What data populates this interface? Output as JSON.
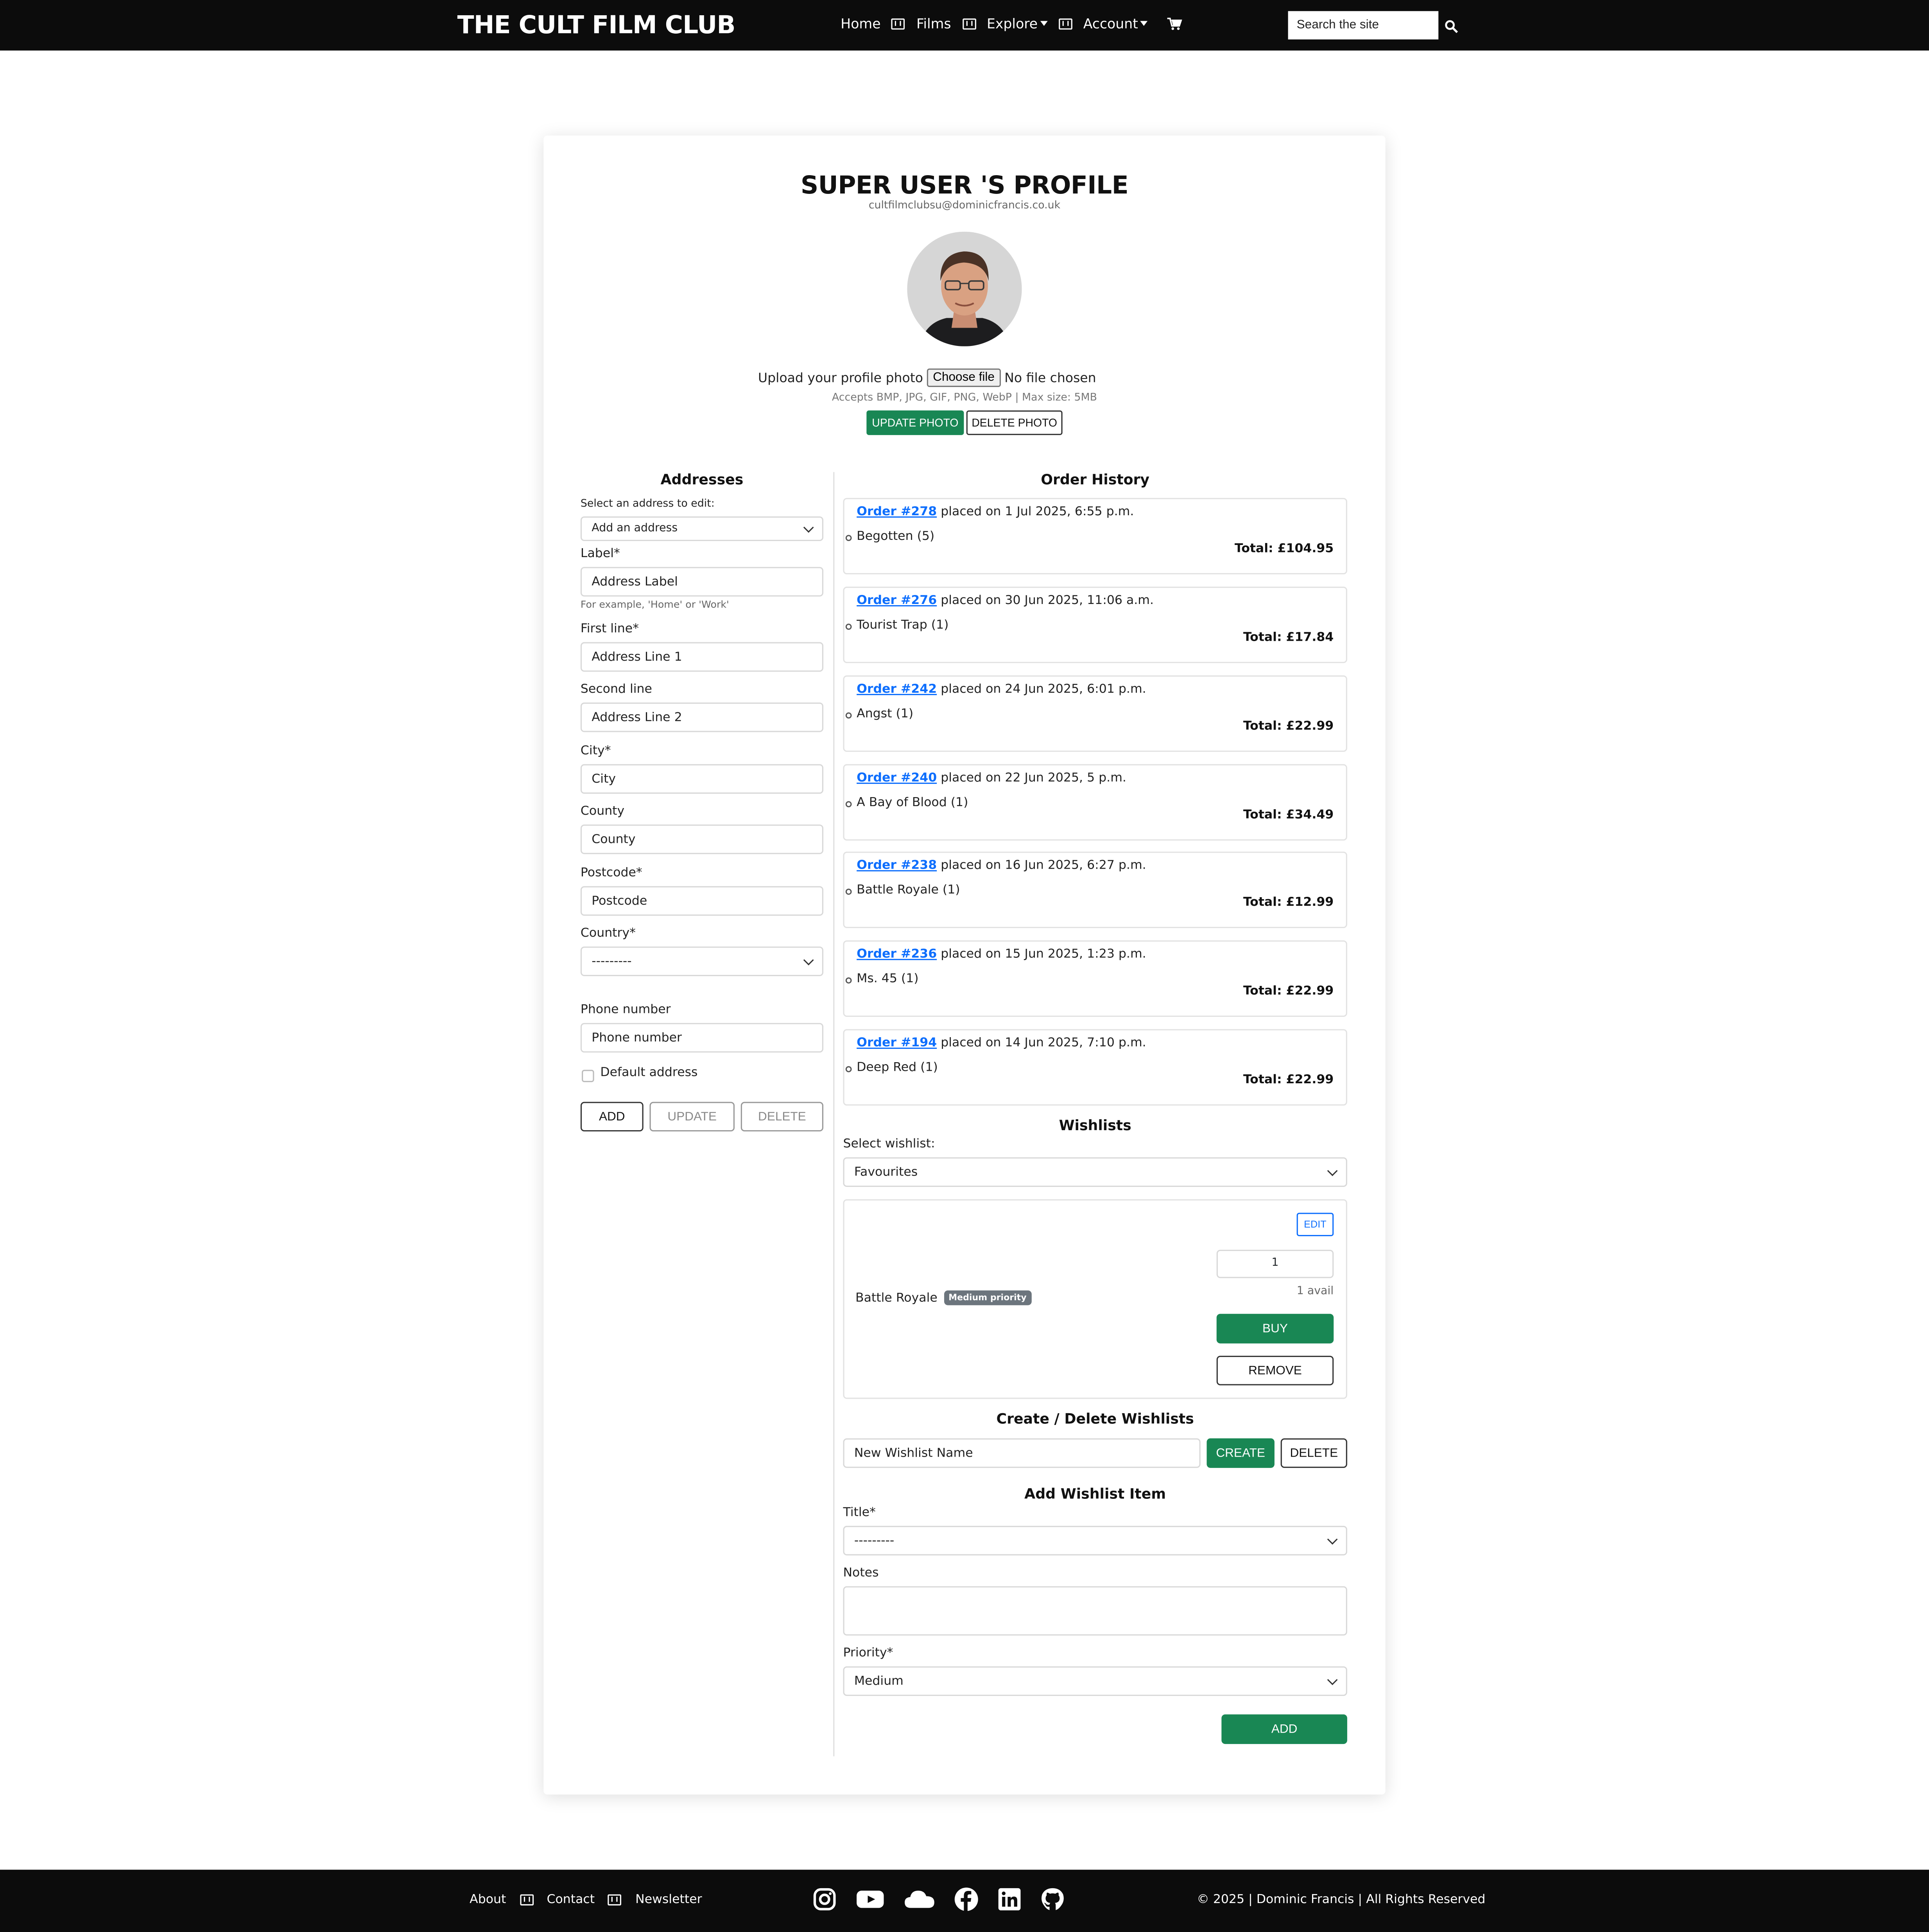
{
  "header": {
    "brand": "THE CULT FILM CLUB",
    "nav": {
      "home": "Home",
      "films": "Films",
      "explore": "Explore",
      "account": "Account"
    },
    "search_placeholder": "Search the site"
  },
  "profile": {
    "title": "SUPER USER 'S PROFILE",
    "email": "cultfilmclubsu@dominicfrancis.co.uk",
    "upload_label": "Upload your profile photo",
    "choose_file": "Choose file",
    "no_file": "No file chosen",
    "accepts": "Accepts BMP, JPG, GIF, PNG, WebP | Max size: 5MB",
    "update_photo": "UPDATE PHOTO",
    "delete_photo": "DELETE PHOTO"
  },
  "addresses": {
    "heading": "Addresses",
    "select_label": "Select an address to edit:",
    "select_value": "Add an address",
    "label_label": "Label*",
    "label_placeholder": "Address Label",
    "label_help": "For example, 'Home' or 'Work'",
    "first_line_label": "First line*",
    "first_line_placeholder": "Address Line 1",
    "second_line_label": "Second line",
    "second_line_placeholder": "Address Line 2",
    "city_label": "City*",
    "city_placeholder": "City",
    "county_label": "County",
    "county_placeholder": "County",
    "postcode_label": "Postcode*",
    "postcode_placeholder": "Postcode",
    "country_label": "Country*",
    "country_value": "---------",
    "phone_label": "Phone number",
    "phone_placeholder": "Phone number",
    "default_label": "Default address",
    "add": "ADD",
    "update": "UPDATE",
    "delete": "DELETE"
  },
  "orders": {
    "heading": "Order History",
    "items": [
      {
        "number": "Order #278",
        "placed": "placed on 1 Jul 2025, 6:55 p.m.",
        "item": "Begotten (5)",
        "total": "Total: £104.95"
      },
      {
        "number": "Order #276",
        "placed": "placed on 30 Jun 2025, 11:06 a.m.",
        "item": "Tourist Trap (1)",
        "total": "Total: £17.84"
      },
      {
        "number": "Order #242",
        "placed": "placed on 24 Jun 2025, 6:01 p.m.",
        "item": "Angst (1)",
        "total": "Total: £22.99"
      },
      {
        "number": "Order #240",
        "placed": "placed on 22 Jun 2025, 5 p.m.",
        "item": "A Bay of Blood (1)",
        "total": "Total: £34.49"
      },
      {
        "number": "Order #238",
        "placed": "placed on 16 Jun 2025, 6:27 p.m.",
        "item": "Battle Royale (1)",
        "total": "Total: £12.99"
      },
      {
        "number": "Order #236",
        "placed": "placed on 15 Jun 2025, 1:23 p.m.",
        "item": "Ms. 45 (1)",
        "total": "Total: £22.99"
      },
      {
        "number": "Order #194",
        "placed": "placed on 14 Jun 2025, 7:10 p.m.",
        "item": "Deep Red (1)",
        "total": "Total: £22.99"
      }
    ]
  },
  "wishlists": {
    "heading": "Wishlists",
    "select_label": "Select wishlist:",
    "select_value": "Favourites",
    "edit": "EDIT",
    "item_title": "Battle Royale",
    "item_priority": "Medium priority",
    "qty": "1",
    "avail": "1 avail",
    "buy": "BUY",
    "remove": "REMOVE",
    "create_heading": "Create / Delete Wishlists",
    "new_name_placeholder": "New Wishlist Name",
    "create": "CREATE",
    "delete": "DELETE",
    "add_item_heading": "Add Wishlist Item",
    "title_label": "Title*",
    "title_value": "---------",
    "notes_label": "Notes",
    "priority_label": "Priority*",
    "priority_value": "Medium",
    "add": "ADD"
  },
  "footer": {
    "about": "About",
    "contact": "Contact",
    "newsletter": "Newsletter",
    "copyright": "© 2025 | Dominic Francis | All Rights Reserved",
    "social_icons": [
      "instagram-icon",
      "youtube-icon",
      "cloud-icon",
      "facebook-icon",
      "linkedin-icon",
      "github-icon"
    ]
  },
  "colors": {
    "navbar": "#0c0c0c",
    "accent_green": "#198754",
    "link_blue": "#0d6efd",
    "badge_grey": "#6c757d"
  }
}
